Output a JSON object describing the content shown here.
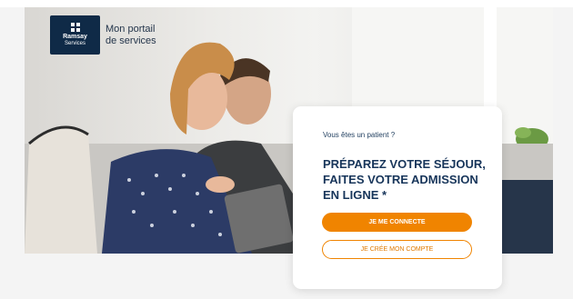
{
  "brand": {
    "logo_name": "Ramsay",
    "logo_sub": "Services",
    "portal_title": "Mon portail\nde services",
    "colors": {
      "navy": "#0f2a47",
      "orange": "#f08400"
    }
  },
  "card": {
    "question": "Vous êtes un patient ?",
    "heading": "PRÉPAREZ VOTRE SÉJOUR, FAITES VOTRE ADMISSION EN LIGNE *",
    "primary_button": "JE ME CONNECTE",
    "secondary_button": "JE CRÉE MON COMPTE"
  }
}
